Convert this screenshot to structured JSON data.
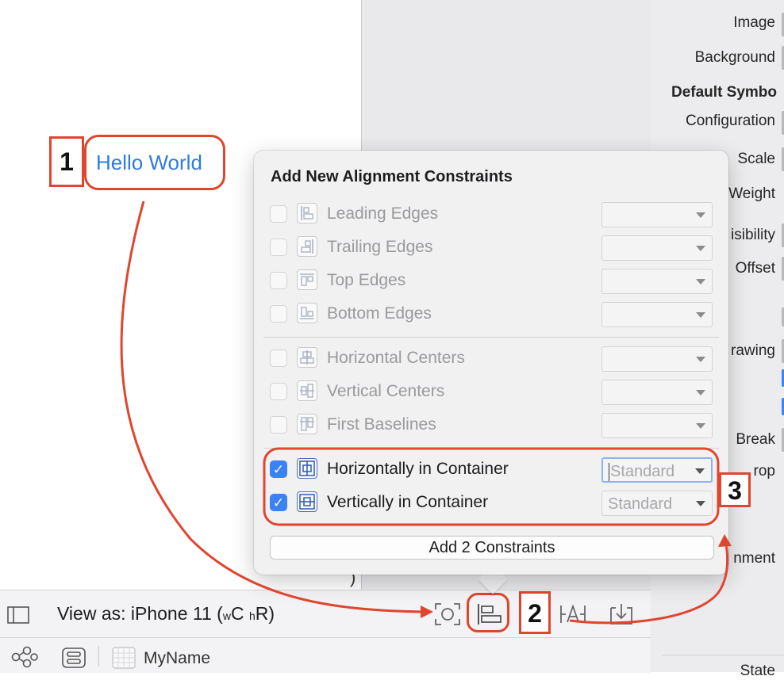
{
  "inspector": {
    "image": "Image",
    "background": "Background",
    "default_symbol": "Default Symbo",
    "configuration": "Configuration",
    "scale": "Scale",
    "weight": "Weight",
    "visibility": "isibility",
    "offset": "Offset",
    "drawing": "rawing",
    "line_break": "Break",
    "drop": "rop",
    "alignment": "nment",
    "state": "State"
  },
  "canvas": {
    "label_text": "Hello World",
    "bracket": ")"
  },
  "annotations": {
    "step1": "1",
    "step2": "2",
    "step3": "3",
    "accent_color": "#e0452d"
  },
  "popover": {
    "title": "Add New Alignment Constraints",
    "rows": [
      {
        "label": "Leading Edges",
        "checked": false,
        "icon": "leading-edges-icon",
        "value": ""
      },
      {
        "label": "Trailing Edges",
        "checked": false,
        "icon": "trailing-edges-icon",
        "value": ""
      },
      {
        "label": "Top Edges",
        "checked": false,
        "icon": "top-edges-icon",
        "value": ""
      },
      {
        "label": "Bottom Edges",
        "checked": false,
        "icon": "bottom-edges-icon",
        "value": ""
      },
      {
        "label": "Horizontal Centers",
        "checked": false,
        "icon": "horizontal-centers-icon",
        "value": ""
      },
      {
        "label": "Vertical Centers",
        "checked": false,
        "icon": "vertical-centers-icon",
        "value": ""
      },
      {
        "label": "First Baselines",
        "checked": false,
        "icon": "first-baselines-icon",
        "value": ""
      },
      {
        "label": "Horizontally in Container",
        "checked": true,
        "icon": "horizontally-in-container-icon",
        "value": "Standard"
      },
      {
        "label": "Vertically in Container",
        "checked": true,
        "icon": "vertically-in-container-icon",
        "value": "Standard"
      }
    ],
    "add_button": "Add 2 Constraints",
    "checkmark": "✓",
    "accent_color": "#3b82f6"
  },
  "bottom_bar": {
    "view_as_prefix": "View as: iPhone 11 (",
    "w_small": "w",
    "w_big": "C",
    "h_small": "h",
    "h_big": "R",
    "view_as_suffix": ")"
  },
  "outline_bar": {
    "scene_name": "MyName"
  }
}
